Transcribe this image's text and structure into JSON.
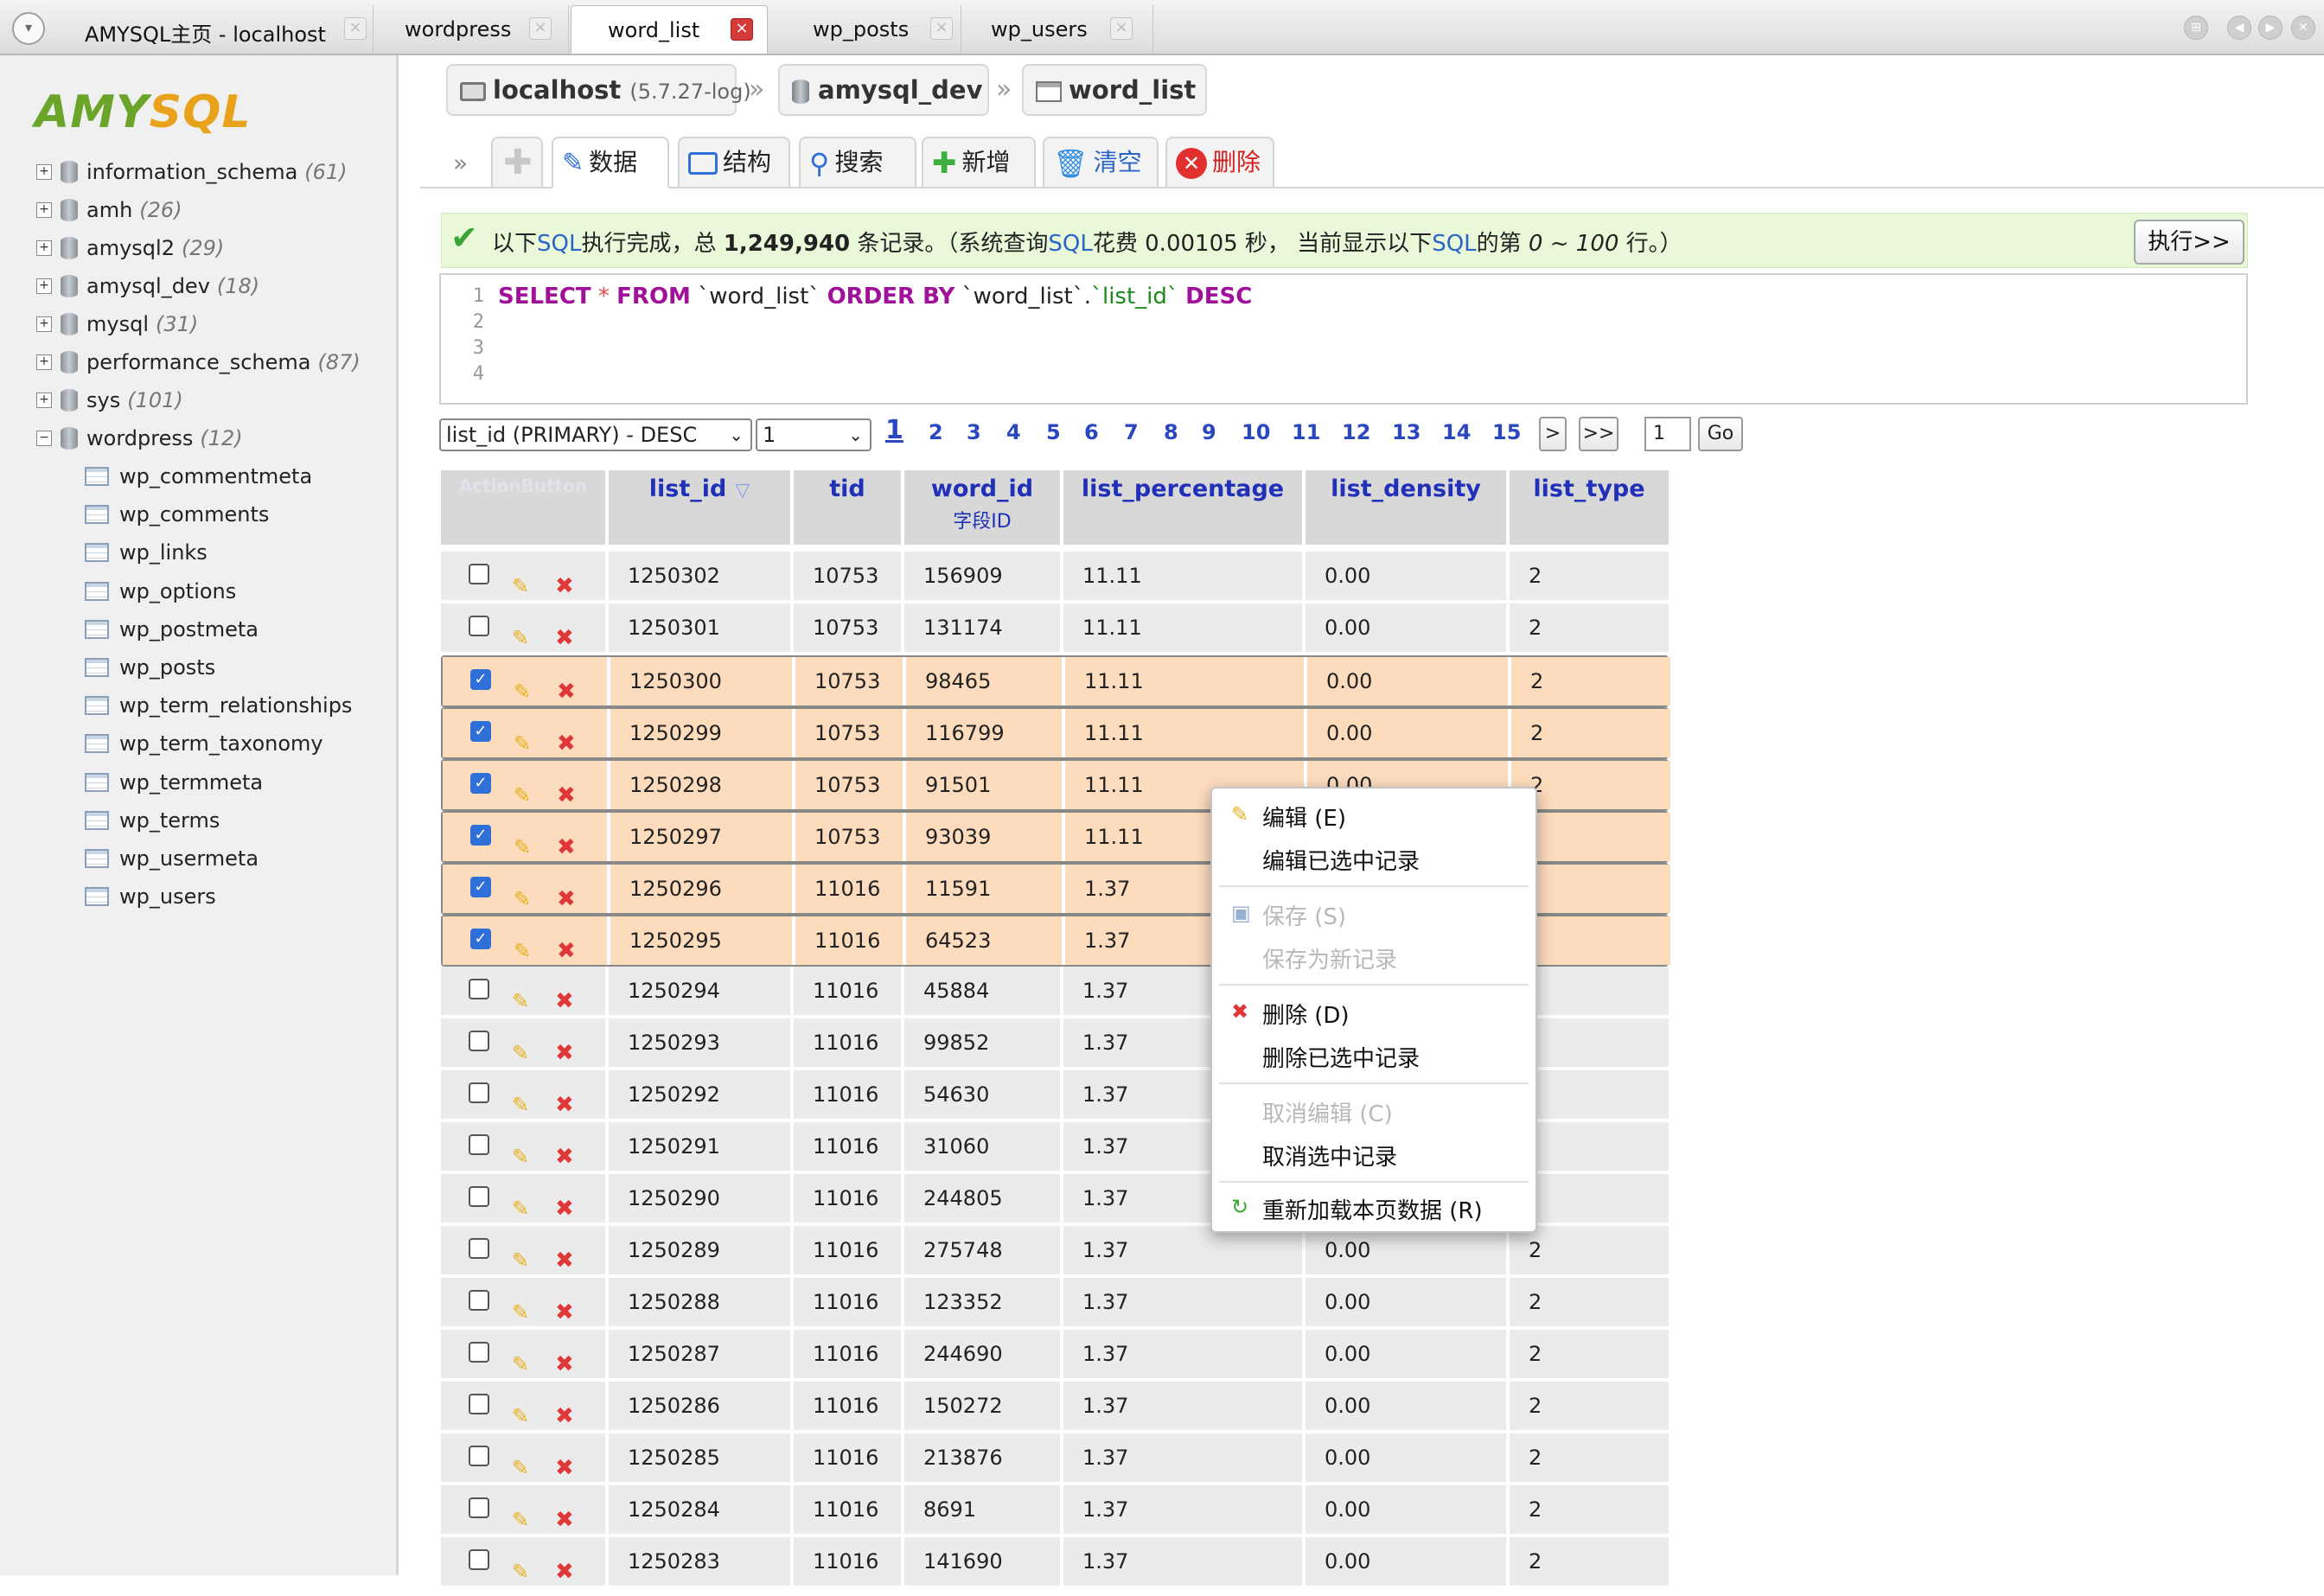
{
  "tabs": [
    {
      "label": "AMYSQL主页 - localhost"
    },
    {
      "label": "wordpress"
    },
    {
      "label": "word_list"
    },
    {
      "label": "wp_posts"
    },
    {
      "label": "wp_users"
    }
  ],
  "close_glyph": "×",
  "logo": {
    "part_a": "AMY",
    "part_b": "SQL"
  },
  "databases": [
    {
      "name": "information_schema",
      "count": "(61)"
    },
    {
      "name": "amh",
      "count": "(26)"
    },
    {
      "name": "amysql2",
      "count": "(29)"
    },
    {
      "name": "amysql_dev",
      "count": "(18)"
    },
    {
      "name": "mysql",
      "count": "(31)"
    },
    {
      "name": "performance_schema",
      "count": "(87)"
    },
    {
      "name": "sys",
      "count": "(101)"
    },
    {
      "name": "wordpress",
      "count": "(12)"
    }
  ],
  "tables": [
    "wp_commentmeta",
    "wp_comments",
    "wp_links",
    "wp_options",
    "wp_postmeta",
    "wp_posts",
    "wp_term_relationships",
    "wp_term_taxonomy",
    "wp_termmeta",
    "wp_terms",
    "wp_usermeta",
    "wp_users"
  ],
  "breadcrumb": {
    "host": "localhost",
    "version": "(5.7.27-log)",
    "sep": "»",
    "db": "amysql_dev",
    "table": "word_list"
  },
  "toolbar": {
    "more": "»",
    "items": [
      "数据",
      "结构",
      "搜索",
      "新增",
      "清空",
      "删除"
    ]
  },
  "status": {
    "p1": "以下",
    "sql": "SQL",
    "p2": "执行完成，总 ",
    "total": "1,249,940",
    "p3": " 条记录。（系统查询",
    "p4": "花费 0.00105 秒， 当前显示以下",
    "p5": "的第 ",
    "range": "0 ~ 100",
    "p6": " 行。）",
    "run_label": "执行>>"
  },
  "editor": {
    "lines": [
      "1",
      "2",
      "3",
      "4"
    ],
    "kw_select": "SELECT",
    "star": "*",
    "kw_from": "FROM",
    "table": "`word_list`",
    "kw_order": "ORDER BY",
    "col_prefix": "`word_list`.",
    "col": "`list_id`",
    "kw_desc": "DESC"
  },
  "pager": {
    "sort_select": "list_id (PRIMARY) - DESC",
    "page_select": "1",
    "pages": [
      "1",
      "2",
      "3",
      "4",
      "5",
      "6",
      "7",
      "8",
      "9",
      "10",
      "11",
      "12",
      "13",
      "14",
      "15"
    ],
    "next": ">",
    "last": ">>",
    "page_input": "1",
    "go": "Go"
  },
  "grid": {
    "ghost_header": "ActionButton",
    "columns": [
      {
        "label": "list_id",
        "sub": ""
      },
      {
        "label": "tid",
        "sub": ""
      },
      {
        "label": "word_id",
        "sub": "字段ID"
      },
      {
        "label": "list_percentage",
        "sub": ""
      },
      {
        "label": "list_density",
        "sub": ""
      },
      {
        "label": "list_type",
        "sub": ""
      }
    ],
    "sort_glyph": "▽",
    "rows": [
      {
        "checked": false,
        "list_id": "1250302",
        "tid": "10753",
        "word_id": "156909",
        "list_percentage": "11.11",
        "list_density": "0.00",
        "list_type": "2"
      },
      {
        "checked": false,
        "list_id": "1250301",
        "tid": "10753",
        "word_id": "131174",
        "list_percentage": "11.11",
        "list_density": "0.00",
        "list_type": "2"
      },
      {
        "checked": true,
        "list_id": "1250300",
        "tid": "10753",
        "word_id": "98465",
        "list_percentage": "11.11",
        "list_density": "0.00",
        "list_type": "2"
      },
      {
        "checked": true,
        "list_id": "1250299",
        "tid": "10753",
        "word_id": "116799",
        "list_percentage": "11.11",
        "list_density": "0.00",
        "list_type": "2"
      },
      {
        "checked": true,
        "list_id": "1250298",
        "tid": "10753",
        "word_id": "91501",
        "list_percentage": "11.11",
        "list_density": "0.00",
        "list_type": "2"
      },
      {
        "checked": true,
        "list_id": "1250297",
        "tid": "10753",
        "word_id": "93039",
        "list_percentage": "11.11",
        "list_density": "",
        "list_type": ""
      },
      {
        "checked": true,
        "list_id": "1250296",
        "tid": "11016",
        "word_id": "11591",
        "list_percentage": "1.37",
        "list_density": "",
        "list_type": ""
      },
      {
        "checked": true,
        "list_id": "1250295",
        "tid": "11016",
        "word_id": "64523",
        "list_percentage": "1.37",
        "list_density": "",
        "list_type": ""
      },
      {
        "checked": false,
        "list_id": "1250294",
        "tid": "11016",
        "word_id": "45884",
        "list_percentage": "1.37",
        "list_density": "",
        "list_type": ""
      },
      {
        "checked": false,
        "list_id": "1250293",
        "tid": "11016",
        "word_id": "99852",
        "list_percentage": "1.37",
        "list_density": "",
        "list_type": ""
      },
      {
        "checked": false,
        "list_id": "1250292",
        "tid": "11016",
        "word_id": "54630",
        "list_percentage": "1.37",
        "list_density": "",
        "list_type": ""
      },
      {
        "checked": false,
        "list_id": "1250291",
        "tid": "11016",
        "word_id": "31060",
        "list_percentage": "1.37",
        "list_density": "",
        "list_type": ""
      },
      {
        "checked": false,
        "list_id": "1250290",
        "tid": "11016",
        "word_id": "244805",
        "list_percentage": "1.37",
        "list_density": "",
        "list_type": ""
      },
      {
        "checked": false,
        "list_id": "1250289",
        "tid": "11016",
        "word_id": "275748",
        "list_percentage": "1.37",
        "list_density": "0.00",
        "list_type": "2"
      },
      {
        "checked": false,
        "list_id": "1250288",
        "tid": "11016",
        "word_id": "123352",
        "list_percentage": "1.37",
        "list_density": "0.00",
        "list_type": "2"
      },
      {
        "checked": false,
        "list_id": "1250287",
        "tid": "11016",
        "word_id": "244690",
        "list_percentage": "1.37",
        "list_density": "0.00",
        "list_type": "2"
      },
      {
        "checked": false,
        "list_id": "1250286",
        "tid": "11016",
        "word_id": "150272",
        "list_percentage": "1.37",
        "list_density": "0.00",
        "list_type": "2"
      },
      {
        "checked": false,
        "list_id": "1250285",
        "tid": "11016",
        "word_id": "213876",
        "list_percentage": "1.37",
        "list_density": "0.00",
        "list_type": "2"
      },
      {
        "checked": false,
        "list_id": "1250284",
        "tid": "11016",
        "word_id": "8691",
        "list_percentage": "1.37",
        "list_density": "0.00",
        "list_type": "2"
      },
      {
        "checked": false,
        "list_id": "1250283",
        "tid": "11016",
        "word_id": "141690",
        "list_percentage": "1.37",
        "list_density": "0.00",
        "list_type": "2"
      }
    ]
  },
  "context_menu": {
    "edit": "编辑 (E)",
    "edit_selected": "编辑已选中记录",
    "save": "保存 (S)",
    "save_new": "保存为新记录",
    "delete": "删除 (D)",
    "delete_selected": "删除已选中记录",
    "cancel_edit": "取消编辑 (C)",
    "deselect": "取消选中记录",
    "reload": "重新加载本页数据 (R)"
  },
  "colors": {
    "selected_row": "#fddcbe",
    "header_bg": "#d8d8d8",
    "link": "#2030b8",
    "success_bg": "#e9f8d9"
  }
}
